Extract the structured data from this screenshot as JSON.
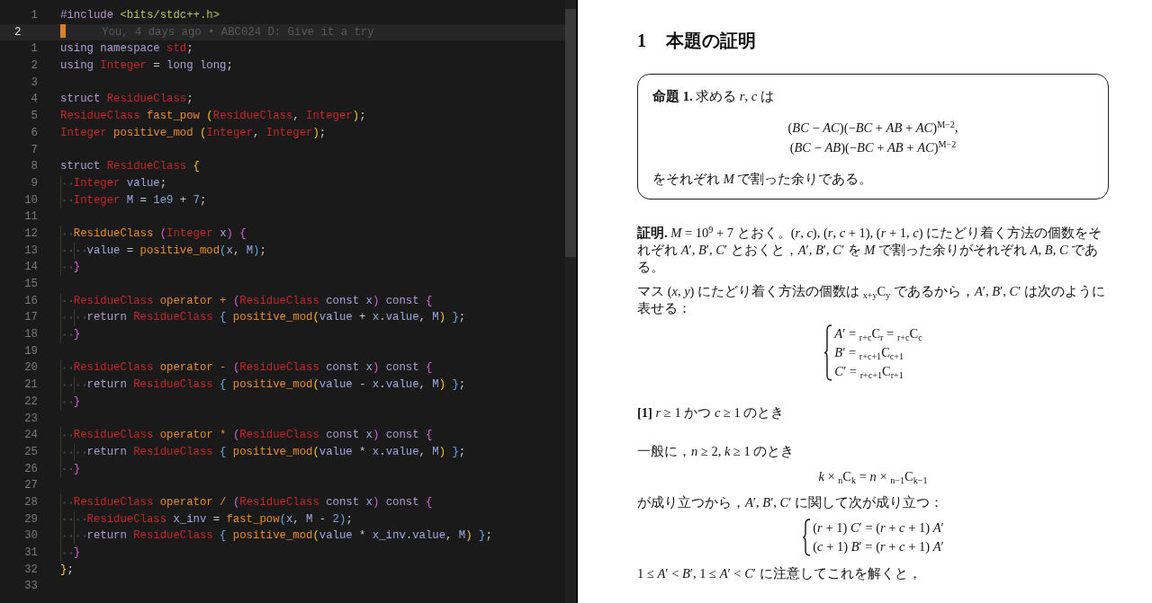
{
  "editor": {
    "lines": [
      {
        "num": "1",
        "current": false,
        "tokens": [
          {
            "kind": "pp",
            "text": "#include "
          },
          {
            "kind": "s",
            "text": "<bits/stdc++.h>"
          }
        ]
      },
      {
        "num": "2",
        "current": true,
        "blame": "You, 4 days ago • ABC024 D: Give it a try"
      },
      {
        "num": "1",
        "current": false,
        "tokens": [
          {
            "kind": "kw",
            "text": "using namespace "
          },
          {
            "kind": "ty",
            "text": "std"
          },
          {
            "kind": "p",
            "text": ";"
          }
        ]
      },
      {
        "num": "2",
        "current": false,
        "tokens": [
          {
            "kind": "kw",
            "text": "using "
          },
          {
            "kind": "ty",
            "text": "Integer"
          },
          {
            "kind": "p",
            "text": " = "
          },
          {
            "kind": "kw",
            "text": "long long"
          },
          {
            "kind": "p",
            "text": ";"
          }
        ]
      },
      {
        "num": "3",
        "current": false
      },
      {
        "num": "4",
        "current": false,
        "tokens": [
          {
            "kind": "kw",
            "text": "struct "
          },
          {
            "kind": "ty",
            "text": "ResidueClass"
          },
          {
            "kind": "p",
            "text": ";"
          }
        ]
      },
      {
        "num": "5",
        "current": false,
        "tokens": [
          {
            "kind": "ty",
            "text": "ResidueClass "
          },
          {
            "kind": "fn",
            "text": "fast_pow "
          },
          {
            "kind": "b1",
            "text": "("
          },
          {
            "kind": "ty",
            "text": "ResidueClass"
          },
          {
            "kind": "p",
            "text": ", "
          },
          {
            "kind": "ty",
            "text": "Integer"
          },
          {
            "kind": "b1",
            "text": ")"
          },
          {
            "kind": "p",
            "text": ";"
          }
        ]
      },
      {
        "num": "6",
        "current": false,
        "tokens": [
          {
            "kind": "ty",
            "text": "Integer "
          },
          {
            "kind": "fn",
            "text": "positive_mod "
          },
          {
            "kind": "b1",
            "text": "("
          },
          {
            "kind": "ty",
            "text": "Integer"
          },
          {
            "kind": "p",
            "text": ", "
          },
          {
            "kind": "ty",
            "text": "Integer"
          },
          {
            "kind": "b1",
            "text": ")"
          },
          {
            "kind": "p",
            "text": ";"
          }
        ]
      },
      {
        "num": "7",
        "current": false
      },
      {
        "num": "8",
        "current": false,
        "tokens": [
          {
            "kind": "kw",
            "text": "struct "
          },
          {
            "kind": "ty",
            "text": "ResidueClass "
          },
          {
            "kind": "b1",
            "text": "{"
          }
        ]
      },
      {
        "num": "9",
        "current": false,
        "tokens": [
          {
            "kind": "ty",
            "text": "  Integer "
          },
          {
            "kind": "v",
            "text": "value"
          },
          {
            "kind": "p",
            "text": ";"
          }
        ]
      },
      {
        "num": "10",
        "current": false,
        "tokens": [
          {
            "kind": "ty",
            "text": "  Integer "
          },
          {
            "kind": "v",
            "text": "M"
          },
          {
            "kind": "p",
            "text": " = "
          },
          {
            "kind": "n",
            "text": "1e9"
          },
          {
            "kind": "p",
            "text": " + "
          },
          {
            "kind": "n",
            "text": "7"
          },
          {
            "kind": "p",
            "text": ";"
          }
        ]
      },
      {
        "num": "11",
        "current": false
      },
      {
        "num": "12",
        "current": false,
        "tokens": [
          {
            "kind": "fn",
            "text": "  ResidueClass "
          },
          {
            "kind": "b2",
            "text": "("
          },
          {
            "kind": "ty",
            "text": "Integer "
          },
          {
            "kind": "v",
            "text": "x"
          },
          {
            "kind": "b2",
            "text": ") {"
          }
        ]
      },
      {
        "num": "13",
        "current": false,
        "tokens": [
          {
            "kind": "v",
            "text": "    value"
          },
          {
            "kind": "p",
            "text": " = "
          },
          {
            "kind": "fn",
            "text": "positive_mod"
          },
          {
            "kind": "b3",
            "text": "("
          },
          {
            "kind": "v",
            "text": "x"
          },
          {
            "kind": "p",
            "text": ", "
          },
          {
            "kind": "v",
            "text": "M"
          },
          {
            "kind": "b3",
            "text": ")"
          },
          {
            "kind": "p",
            "text": ";"
          }
        ]
      },
      {
        "num": "14",
        "current": false,
        "tokens": [
          {
            "kind": "b2",
            "text": "  }"
          }
        ]
      },
      {
        "num": "15",
        "current": false
      },
      {
        "num": "16",
        "current": false,
        "tokens": [
          {
            "kind": "ty",
            "text": "  ResidueClass "
          },
          {
            "kind": "fn",
            "text": "operator + "
          },
          {
            "kind": "b2",
            "text": "("
          },
          {
            "kind": "ty",
            "text": "ResidueClass "
          },
          {
            "kind": "kw",
            "text": "const "
          },
          {
            "kind": "v",
            "text": "x"
          },
          {
            "kind": "b2",
            "text": ") "
          },
          {
            "kind": "kw",
            "text": "const "
          },
          {
            "kind": "b2",
            "text": "{"
          }
        ]
      },
      {
        "num": "17",
        "current": false,
        "tokens": [
          {
            "kind": "kw",
            "text": "    return "
          },
          {
            "kind": "ty",
            "text": "ResidueClass "
          },
          {
            "kind": "b3",
            "text": "{ "
          },
          {
            "kind": "fn",
            "text": "positive_mod"
          },
          {
            "kind": "b1",
            "text": "("
          },
          {
            "kind": "v",
            "text": "value"
          },
          {
            "kind": "p",
            "text": " + "
          },
          {
            "kind": "v",
            "text": "x"
          },
          {
            "kind": "p",
            "text": "."
          },
          {
            "kind": "v",
            "text": "value"
          },
          {
            "kind": "p",
            "text": ", "
          },
          {
            "kind": "v",
            "text": "M"
          },
          {
            "kind": "b1",
            "text": ") "
          },
          {
            "kind": "b3",
            "text": "}"
          },
          {
            "kind": "p",
            "text": ";"
          }
        ]
      },
      {
        "num": "18",
        "current": false,
        "tokens": [
          {
            "kind": "b2",
            "text": "  }"
          }
        ]
      },
      {
        "num": "19",
        "current": false
      },
      {
        "num": "20",
        "current": false,
        "tokens": [
          {
            "kind": "ty",
            "text": "  ResidueClass "
          },
          {
            "kind": "fn",
            "text": "operator - "
          },
          {
            "kind": "b2",
            "text": "("
          },
          {
            "kind": "ty",
            "text": "ResidueClass "
          },
          {
            "kind": "kw",
            "text": "const "
          },
          {
            "kind": "v",
            "text": "x"
          },
          {
            "kind": "b2",
            "text": ") "
          },
          {
            "kind": "kw",
            "text": "const "
          },
          {
            "kind": "b2",
            "text": "{"
          }
        ]
      },
      {
        "num": "21",
        "current": false,
        "tokens": [
          {
            "kind": "kw",
            "text": "    return "
          },
          {
            "kind": "ty",
            "text": "ResidueClass "
          },
          {
            "kind": "b3",
            "text": "{ "
          },
          {
            "kind": "fn",
            "text": "positive_mod"
          },
          {
            "kind": "b1",
            "text": "("
          },
          {
            "kind": "v",
            "text": "value"
          },
          {
            "kind": "p",
            "text": " - "
          },
          {
            "kind": "v",
            "text": "x"
          },
          {
            "kind": "p",
            "text": "."
          },
          {
            "kind": "v",
            "text": "value"
          },
          {
            "kind": "p",
            "text": ", "
          },
          {
            "kind": "v",
            "text": "M"
          },
          {
            "kind": "b1",
            "text": ") "
          },
          {
            "kind": "b3",
            "text": "}"
          },
          {
            "kind": "p",
            "text": ";"
          }
        ]
      },
      {
        "num": "22",
        "current": false,
        "tokens": [
          {
            "kind": "b2",
            "text": "  }"
          }
        ]
      },
      {
        "num": "23",
        "current": false
      },
      {
        "num": "24",
        "current": false,
        "tokens": [
          {
            "kind": "ty",
            "text": "  ResidueClass "
          },
          {
            "kind": "fn",
            "text": "operator * "
          },
          {
            "kind": "b2",
            "text": "("
          },
          {
            "kind": "ty",
            "text": "ResidueClass "
          },
          {
            "kind": "kw",
            "text": "const "
          },
          {
            "kind": "v",
            "text": "x"
          },
          {
            "kind": "b2",
            "text": ") "
          },
          {
            "kind": "kw",
            "text": "const "
          },
          {
            "kind": "b2",
            "text": "{"
          }
        ]
      },
      {
        "num": "25",
        "current": false,
        "tokens": [
          {
            "kind": "kw",
            "text": "    return "
          },
          {
            "kind": "ty",
            "text": "ResidueClass "
          },
          {
            "kind": "b3",
            "text": "{ "
          },
          {
            "kind": "fn",
            "text": "positive_mod"
          },
          {
            "kind": "b1",
            "text": "("
          },
          {
            "kind": "v",
            "text": "value"
          },
          {
            "kind": "p",
            "text": " * "
          },
          {
            "kind": "v",
            "text": "x"
          },
          {
            "kind": "p",
            "text": "."
          },
          {
            "kind": "v",
            "text": "value"
          },
          {
            "kind": "p",
            "text": ", "
          },
          {
            "kind": "v",
            "text": "M"
          },
          {
            "kind": "b1",
            "text": ") "
          },
          {
            "kind": "b3",
            "text": "}"
          },
          {
            "kind": "p",
            "text": ";"
          }
        ]
      },
      {
        "num": "26",
        "current": false,
        "tokens": [
          {
            "kind": "b2",
            "text": "  }"
          }
        ]
      },
      {
        "num": "27",
        "current": false
      },
      {
        "num": "28",
        "current": false,
        "tokens": [
          {
            "kind": "ty",
            "text": "  ResidueClass "
          },
          {
            "kind": "fn",
            "text": "operator / "
          },
          {
            "kind": "b2",
            "text": "("
          },
          {
            "kind": "ty",
            "text": "ResidueClass "
          },
          {
            "kind": "kw",
            "text": "const "
          },
          {
            "kind": "v",
            "text": "x"
          },
          {
            "kind": "b2",
            "text": ") "
          },
          {
            "kind": "kw",
            "text": "const "
          },
          {
            "kind": "b2",
            "text": "{"
          }
        ]
      },
      {
        "num": "29",
        "current": false,
        "tokens": [
          {
            "kind": "ty",
            "text": "    ResidueClass "
          },
          {
            "kind": "v",
            "text": "x_inv"
          },
          {
            "kind": "p",
            "text": " = "
          },
          {
            "kind": "fn",
            "text": "fast_pow"
          },
          {
            "kind": "b3",
            "text": "("
          },
          {
            "kind": "v",
            "text": "x"
          },
          {
            "kind": "p",
            "text": ", "
          },
          {
            "kind": "v",
            "text": "M"
          },
          {
            "kind": "p",
            "text": " - "
          },
          {
            "kind": "n",
            "text": "2"
          },
          {
            "kind": "b3",
            "text": ")"
          },
          {
            "kind": "p",
            "text": ";"
          }
        ]
      },
      {
        "num": "30",
        "current": false,
        "tokens": [
          {
            "kind": "kw",
            "text": "    return "
          },
          {
            "kind": "ty",
            "text": "ResidueClass "
          },
          {
            "kind": "b3",
            "text": "{ "
          },
          {
            "kind": "fn",
            "text": "positive_mod"
          },
          {
            "kind": "b1",
            "text": "("
          },
          {
            "kind": "v",
            "text": "value"
          },
          {
            "kind": "p",
            "text": " * "
          },
          {
            "kind": "v",
            "text": "x_inv"
          },
          {
            "kind": "p",
            "text": "."
          },
          {
            "kind": "v",
            "text": "value"
          },
          {
            "kind": "p",
            "text": ", "
          },
          {
            "kind": "v",
            "text": "M"
          },
          {
            "kind": "b1",
            "text": ") "
          },
          {
            "kind": "b3",
            "text": "}"
          },
          {
            "kind": "p",
            "text": ";"
          }
        ]
      },
      {
        "num": "31",
        "current": false,
        "tokens": [
          {
            "kind": "b2",
            "text": "  }"
          }
        ]
      },
      {
        "num": "32",
        "current": false,
        "tokens": [
          {
            "kind": "b1",
            "text": "}"
          },
          {
            "kind": "p",
            "text": ";"
          }
        ]
      },
      {
        "num": "33",
        "current": false
      }
    ]
  },
  "document": {
    "section": {
      "number": "1",
      "title": "本題の証明"
    },
    "proposition": {
      "lead": "**命題 1.** 求める *r*, *c* は",
      "equations": [
        "(*BC* − *AC*)(−*BC* + *AB* + *AC*)$^{M−2}$,",
        "(*BC* − *AB*)(−*BC* + *AB* + *AC*)$^{M−2}$"
      ],
      "tail": "をそれぞれ *M* で割った余りである。"
    },
    "blocks": [
      {
        "kind": "para",
        "text": "**証明.** *M* = 10$^{9}$ + 7 とおく。(*r*, *c*), (*r*, *c* + 1), (*r* + 1, *c*) にたどり着く方法の個数をそれぞれ *A*′, *B*′, *C*′ とおくと，*A*′, *B*′, *C*′ を *M* で割った余りがそれぞれ *A*, *B*, *C* である。"
      },
      {
        "kind": "para",
        "text": "マス (*x*, *y*) にたどり着く方法の個数は $_{x+y}$C$_{y}$ であるから，*A*′, *B*′, *C*′ は次のように表せる："
      },
      {
        "kind": "cases",
        "lines": [
          "*A*′ = $_{r+c}$C$_{r}$ = $_{r+c}$C$_{c}$",
          "*B*′ = $_{r+c+1}$C$_{c+1}$",
          "*C*′ = $_{r+c+1}$C$_{r+1}$"
        ]
      },
      {
        "kind": "heading",
        "text": "**[1]** *r* ≥ 1 かつ *c* ≥ 1 のとき"
      },
      {
        "kind": "para",
        "text": "一般に，*n* ≥ 2, *k* ≥ 1 のとき"
      },
      {
        "kind": "display",
        "text": "*k* × $_{n}$C$_{k}$ = *n* × $_{n−1}$C$_{k−1}$"
      },
      {
        "kind": "para",
        "text": "が成り立つから，*A*′, *B*′, *C*′ に関して次が成り立つ："
      },
      {
        "kind": "cases",
        "lines": [
          "(*r* + 1) *C*′ = (*r* + *c* + 1) *A*′",
          "(*c* + 1) *B*′ = (*r* + *c* + 1) *A*′"
        ]
      },
      {
        "kind": "para",
        "text": "1 ≤ *A*′ < *B*′, 1 ≤ *A*′ < *C*′ に注意してこれを解くと，"
      }
    ]
  }
}
